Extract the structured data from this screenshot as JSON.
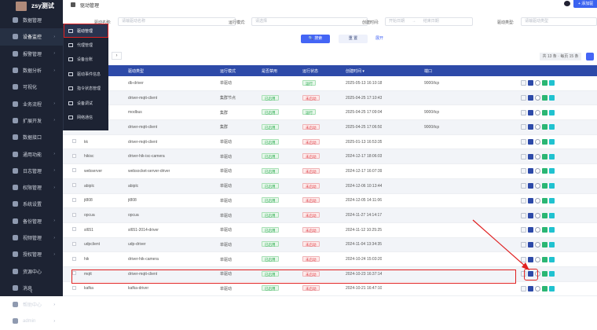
{
  "app": {
    "user": "zsy测试",
    "page_title": "驱动管理",
    "add_button": "+ 添加驱"
  },
  "sidebar": {
    "items": [
      {
        "label": "数据管理",
        "arrow": ""
      },
      {
        "label": "设备监控",
        "arrow": "›"
      },
      {
        "label": "报警管理",
        "arrow": "›"
      },
      {
        "label": "数据分析",
        "arrow": "›"
      },
      {
        "label": "可视化",
        "arrow": ""
      },
      {
        "label": "业务流程",
        "arrow": "›"
      },
      {
        "label": "扩展开发",
        "arrow": "›"
      },
      {
        "label": "数据接口",
        "arrow": ""
      },
      {
        "label": "通用功能",
        "arrow": "›"
      },
      {
        "label": "日志管理",
        "arrow": "›"
      },
      {
        "label": "权限管理",
        "arrow": "›"
      },
      {
        "label": "系统设置",
        "arrow": ""
      },
      {
        "label": "备份管理",
        "arrow": "›"
      },
      {
        "label": "视频管理",
        "arrow": "›"
      },
      {
        "label": "授权管理",
        "arrow": "›"
      },
      {
        "label": "资源中心",
        "arrow": ""
      },
      {
        "label": "消息",
        "arrow": ""
      },
      {
        "label": "帮助中心",
        "arrow": "›"
      },
      {
        "label": "admin",
        "arrow": "›"
      }
    ],
    "collapse": "‹"
  },
  "submenu": {
    "items": [
      "驱动管理",
      "代理管理",
      "设备台账",
      "驱动事件信息",
      "指令状态管理",
      "设备调试",
      "网络通信"
    ]
  },
  "filters": {
    "name_label": "驱动名称:",
    "name_ph": "请输驱动名称",
    "mode_label": "运行模式:",
    "mode_ph": "请选择",
    "time_label": "创建时间:",
    "start_ph": "开始日期",
    "sep": "→",
    "end_ph": "结束日期",
    "type_label": "驱动类型:",
    "type_ph": "请输驱动类型"
  },
  "buttons": {
    "search": "🔍 搜索",
    "reset": "重 置",
    "expand": "展开"
  },
  "pager": {
    "next": "›",
    "total": "共 13 条 · 每页 15 条"
  },
  "table": {
    "headers": [
      "驱动类型",
      "运行模式",
      "是否禁用",
      "运行状态",
      "创建时间 ▾",
      "端口"
    ],
    "rows": [
      {
        "name": "",
        "type": "db-driver",
        "mode": "单驱动",
        "disabled": "",
        "status": "运行",
        "st": "g",
        "time": "2025-05-13 16:10:18",
        "port": "9000/tcp"
      },
      {
        "name": "",
        "type": "driver-mqtt-client",
        "mode": "集群节点",
        "disabled": "已启用",
        "status": "未启动",
        "st": "r",
        "time": "2025-04-25 17:10:43",
        "port": ""
      },
      {
        "name": "",
        "type": "modbus",
        "mode": "集群",
        "disabled": "已启用",
        "status": "运行",
        "st": "g",
        "time": "2025-04-25 17:09:04",
        "port": "9000/tcp"
      },
      {
        "name": "",
        "type": "driver-mqtt-client",
        "mode": "集群",
        "disabled": "已启用",
        "status": "未启动",
        "st": "r",
        "time": "2025-04-25 17:06:50",
        "port": "9000/tcp"
      },
      {
        "name": "kk",
        "type": "driver-mqtt-client",
        "mode": "单驱动",
        "disabled": "已启用",
        "status": "未启动",
        "st": "r",
        "time": "2025-01-13 16:53:35",
        "port": ""
      },
      {
        "name": "hikisc",
        "type": "driver-hik-isc-camera",
        "mode": "单驱动",
        "disabled": "已启用",
        "status": "未启动",
        "st": "r",
        "time": "2024-12-17 18:06:03",
        "port": ""
      },
      {
        "name": "webserver",
        "type": "websocket-server-driver",
        "mode": "单驱动",
        "disabled": "已启用",
        "status": "未启动",
        "st": "r",
        "time": "2024-12-17 16:07:39",
        "port": ""
      },
      {
        "name": "abiplc",
        "type": "abiplc",
        "mode": "单驱动",
        "disabled": "已启用",
        "status": "未启动",
        "st": "r",
        "time": "2024-12-06 10:13:44",
        "port": ""
      },
      {
        "name": "jt808",
        "type": "jt808",
        "mode": "单驱动",
        "disabled": "已启用",
        "status": "未启动",
        "st": "r",
        "time": "2024-12-05 14:11:06",
        "port": ""
      },
      {
        "name": "opcua",
        "type": "opcua",
        "mode": "单驱动",
        "disabled": "已启用",
        "status": "未启动",
        "st": "r",
        "time": "2024-11-27 14:14:17",
        "port": ""
      },
      {
        "name": "sl651",
        "type": "sl651-2014-driver",
        "mode": "单驱动",
        "disabled": "已启用",
        "status": "未启动",
        "st": "r",
        "time": "2024-11-12 10:25:25",
        "port": ""
      },
      {
        "name": "udpclient",
        "type": "udp-driver",
        "mode": "单驱动",
        "disabled": "已启用",
        "status": "未启动",
        "st": "r",
        "time": "2024-11-04 13:34:35",
        "port": ""
      },
      {
        "name": "hik",
        "type": "driver-hik-camera",
        "mode": "单驱动",
        "disabled": "已启用",
        "status": "未启动",
        "st": "r",
        "time": "2024-10-24 15:03:20",
        "port": ""
      },
      {
        "name": "mqtt",
        "type": "driver-mqtt-client",
        "mode": "单驱动",
        "disabled": "已启用",
        "status": "未启动",
        "st": "r",
        "time": "2024-10-23 16:37:14",
        "port": ""
      },
      {
        "name": "kafka",
        "type": "kafka-driver",
        "mode": "单驱动",
        "disabled": "已启用",
        "status": "未启动",
        "st": "r",
        "time": "2024-10-21 16:47:10",
        "port": ""
      }
    ]
  }
}
